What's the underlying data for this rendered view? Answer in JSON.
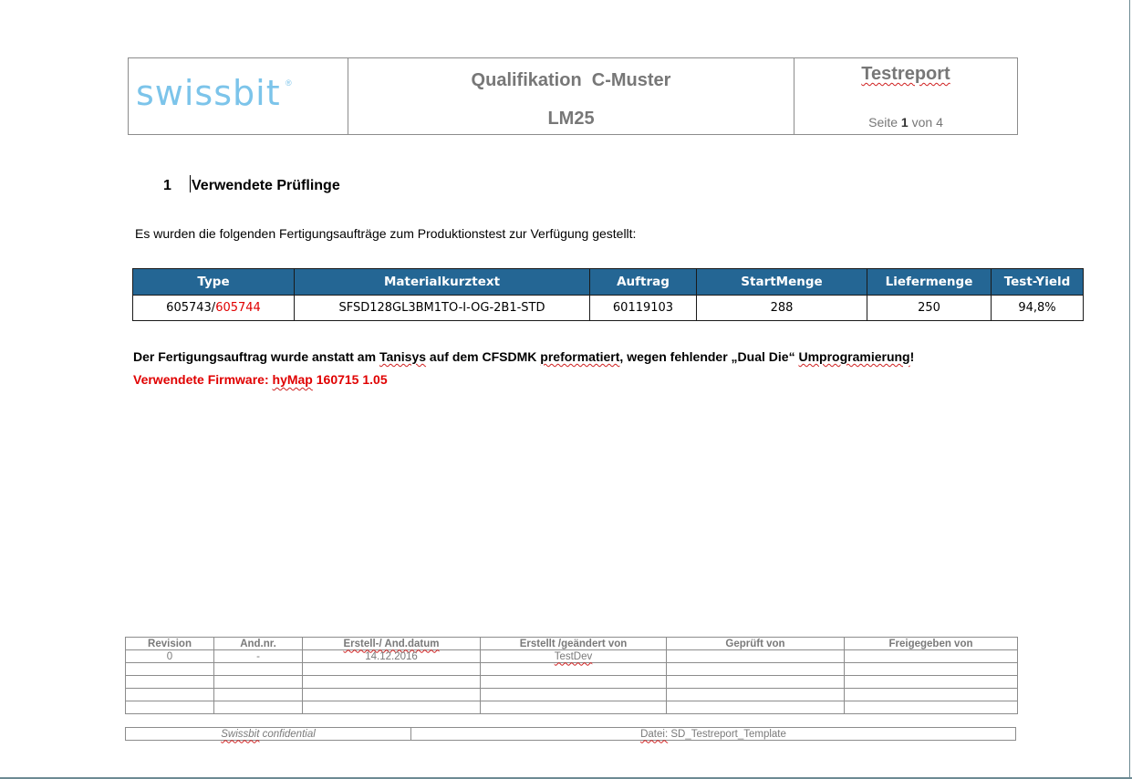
{
  "header": {
    "logo_text": "swissbit",
    "logo_mark": "®",
    "title": "Qualifikation  C-Muster",
    "subtitle": "LM25",
    "report_label": "Testreport",
    "page_prefix": "Seite ",
    "page_current": "1",
    "page_mid": " von ",
    "page_total": "4"
  },
  "section": {
    "number": "1",
    "heading_first_char": "V",
    "heading_rest": "erwendete Prüflinge"
  },
  "intro_text": "Es wurden die folgenden Fertigungsaufträge zum Produktionstest zur Verfügung gestellt:",
  "orders_table": {
    "headers": [
      "Type",
      "Materialkurztext",
      "Auftrag",
      "StartMenge",
      "Liefermenge",
      "Test-Yield"
    ],
    "row": {
      "type_part1": "605743/",
      "type_part2": "605744",
      "material": "SFSD128GL3BM1TO-I-OG-2B1-STD",
      "auftrag": "60119103",
      "startmenge": "288",
      "liefermenge": "250",
      "yield": "94,8%"
    }
  },
  "note": {
    "p1": "Der Fertigungsauftrag wurde anstatt am ",
    "w1": "Tanisys",
    "p2": " auf dem CFSDMK ",
    "w2": "preformatiert",
    "p3": ", wegen fehlender „Dual Die“ ",
    "w3": "Umprogramierung",
    "p4": "!"
  },
  "firmware": {
    "prefix": "Verwendete Firmware: ",
    "w1": "hyMap",
    "suffix": " 160715 1.05"
  },
  "revision_table": {
    "headers": [
      "Revision",
      "And.nr.",
      "Erstell-/ And.datum",
      "Erstellt /geändert von",
      "Geprüft von",
      "Freigegeben von"
    ],
    "rows": [
      [
        "0",
        "-",
        "14.12.2016",
        "TestDev",
        "",
        ""
      ]
    ]
  },
  "footer": {
    "conf_word": "Swissbit",
    "conf_rest": " confidential",
    "file_word": "Datei:",
    "file_rest": " SD_Testreport_Template"
  },
  "colors": {
    "table_header_bg": "#246694",
    "logo": "#7cc4ea",
    "highlight_red": "#e00000"
  }
}
